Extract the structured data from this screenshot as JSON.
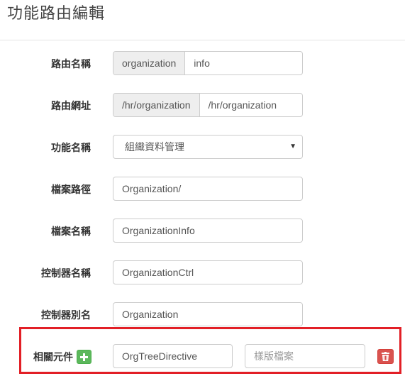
{
  "page": {
    "title": "功能路由編輯"
  },
  "form": {
    "route_name": {
      "label": "路由名稱",
      "prefix": "organization",
      "value": "info"
    },
    "route_url": {
      "label": "路由網址",
      "prefix": "/hr/organization",
      "value": "/hr/organization"
    },
    "function_name": {
      "label": "功能名稱",
      "selected": "組織資料管理"
    },
    "file_path": {
      "label": "檔案路徑",
      "value": "Organization/"
    },
    "file_name": {
      "label": "檔案名稱",
      "value": "OrganizationInfo"
    },
    "controller_name": {
      "label": "控制器名稱",
      "value": "OrganizationCtrl"
    },
    "controller_alias": {
      "label": "控制器別名",
      "value": "Organization"
    }
  },
  "components": {
    "label": "相關元件",
    "add_icon": "plus-icon",
    "items": [
      {
        "name": "OrgTreeDirective",
        "template_placeholder": "樣版檔案",
        "delete_icon": "trash-icon"
      }
    ]
  },
  "colors": {
    "highlight": "#e21f26",
    "add": "#5cb85c",
    "delete": "#d9534f"
  }
}
